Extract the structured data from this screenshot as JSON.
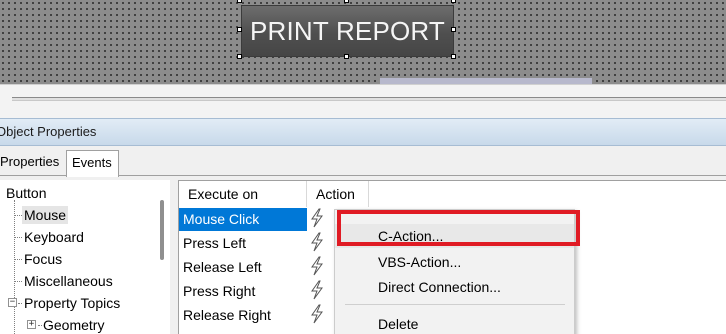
{
  "canvas": {
    "print_button_label": "PRINT REPORT"
  },
  "object_properties": {
    "title": "Object Properties",
    "tabs": [
      {
        "label": "Properties",
        "active": false
      },
      {
        "label": "Events",
        "active": true
      }
    ]
  },
  "tree": {
    "items": [
      {
        "label": "Button"
      },
      {
        "label": "Mouse",
        "selected": true
      },
      {
        "label": "Keyboard"
      },
      {
        "label": "Focus"
      },
      {
        "label": "Miscellaneous"
      },
      {
        "label": "Property Topics",
        "expander": "−"
      },
      {
        "label": "Geometry",
        "expander": "+"
      }
    ]
  },
  "events_grid": {
    "columns": [
      "Execute on",
      "Action"
    ],
    "rows": [
      {
        "label": "Mouse Click",
        "selected": true,
        "icon": "lightning-icon"
      },
      {
        "label": "Press Left",
        "icon": "lightning-icon"
      },
      {
        "label": "Release Left",
        "icon": "lightning-icon"
      },
      {
        "label": "Press Right",
        "icon": "lightning-icon"
      },
      {
        "label": "Release Right",
        "icon": "lightning-icon"
      }
    ]
  },
  "context_menu": {
    "items": [
      {
        "label": "C-Action...",
        "hover": true
      },
      {
        "label": "VBS-Action..."
      },
      {
        "label": "Direct Connection..."
      },
      {
        "label": "Delete"
      }
    ]
  },
  "colors": {
    "selection": "#0078d7",
    "highlight_box": "#e01b24"
  }
}
